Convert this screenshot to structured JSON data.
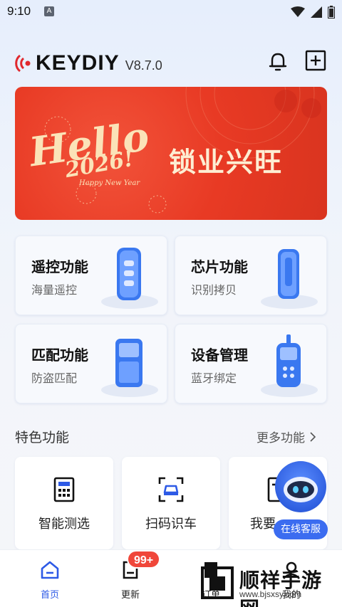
{
  "status_bar": {
    "time": "9:10",
    "notification_icon": "A"
  },
  "header": {
    "brand": "KEYDIY",
    "version": "V8.7.0",
    "bell_icon": "bell-icon",
    "add_icon": "plus-square-icon"
  },
  "banner": {
    "headline": "Hello",
    "year_text": "2026!",
    "tagline": "Happy New Year",
    "slogan": "锁业兴旺"
  },
  "functions": [
    {
      "title": "遥控功能",
      "subtitle": "海量遥控"
    },
    {
      "title": "芯片功能",
      "subtitle": "识别拷贝"
    },
    {
      "title": "匹配功能",
      "subtitle": "防盗匹配"
    },
    {
      "title": "设备管理",
      "subtitle": "蓝牙绑定"
    }
  ],
  "features_section": {
    "title": "特色功能",
    "more_label": "更多功能"
  },
  "features": [
    {
      "label": "智能测选",
      "icon": "calculator-icon"
    },
    {
      "label": "扫码识车",
      "icon": "scan-car-icon"
    },
    {
      "label": "我要",
      "icon": "doc-icon"
    }
  ],
  "service": {
    "label": "在线客服"
  },
  "bottom_nav": [
    {
      "label": "首页",
      "icon": "home-icon",
      "active": true
    },
    {
      "label": "更新",
      "icon": "update-icon",
      "badge": "99+"
    },
    {
      "label": "订单",
      "icon": "order-icon"
    },
    {
      "label": "我的",
      "icon": "user-icon"
    }
  ],
  "watermark": {
    "text": "顺祥手游网",
    "url": "www.bjsxsy.com"
  },
  "colors": {
    "accent": "#2d5ae6",
    "banner": "#e83a24",
    "badge": "#f0473a",
    "logo_red": "#e0282e"
  }
}
